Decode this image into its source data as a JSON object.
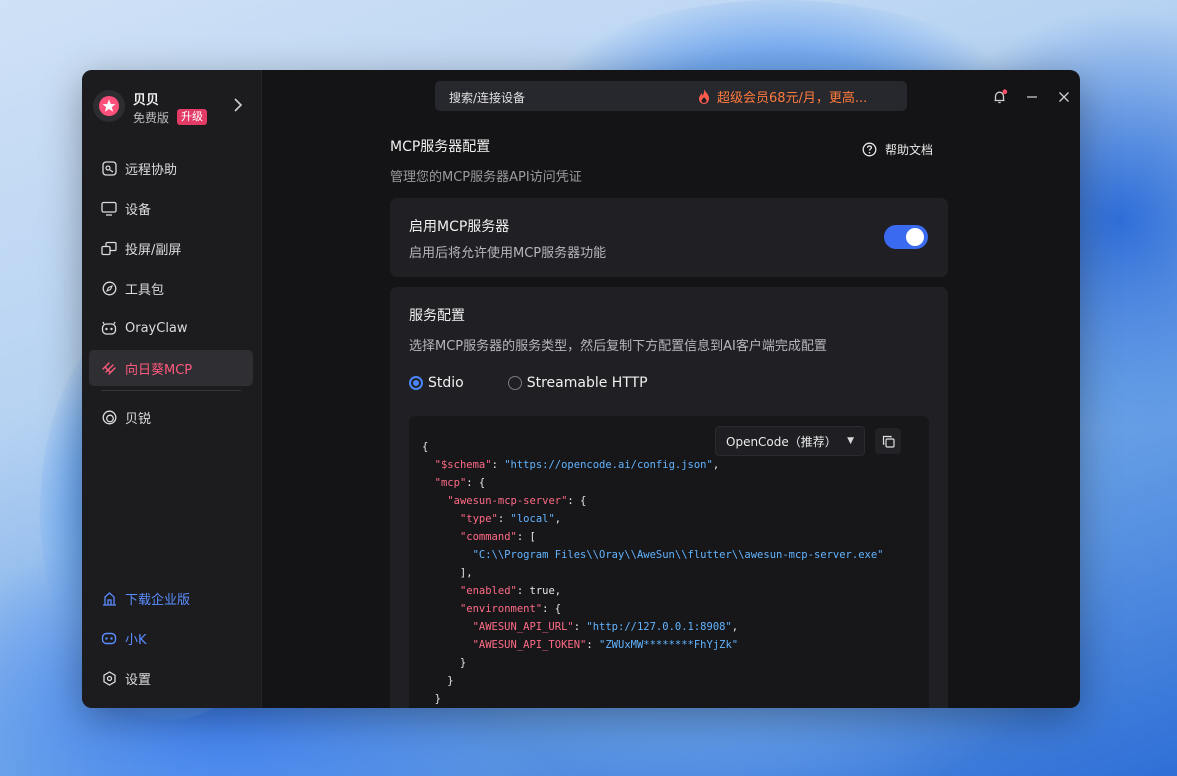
{
  "app": {
    "profile": {
      "name": "贝贝",
      "plan": "免费版",
      "upgrade": "升级"
    },
    "nav": [
      {
        "label": "远程协助",
        "icon": "remote-assist-icon"
      },
      {
        "label": "设备",
        "icon": "monitor-icon"
      },
      {
        "label": "投屏/副屏",
        "icon": "cast-screen-icon"
      },
      {
        "label": "工具包",
        "icon": "compass-icon"
      },
      {
        "label": "OrayClaw",
        "icon": "claw-robot-icon"
      },
      {
        "label": "向日葵MCP",
        "icon": "mcp-icon",
        "active": true
      },
      {
        "label": "贝锐",
        "icon": "oray-icon"
      }
    ],
    "nav_bottom": [
      {
        "label": "下载企业版",
        "icon": "enterprise-building-icon"
      },
      {
        "label": "小K",
        "icon": "assistant-k-icon"
      },
      {
        "label": "设置",
        "icon": "settings-hexagon-icon"
      }
    ],
    "accent": "#ff5a7d"
  },
  "topbar": {
    "search_placeholder": "搜索/连接设备",
    "promo": "超级会员68元/月，更高..."
  },
  "page": {
    "title": "MCP服务器配置",
    "subtitle": "管理您的MCP服务器API访问凭证",
    "help": "帮助文档",
    "enable_card": {
      "title": "启用MCP服务器",
      "desc": "启用后将允许使用MCP服务器功能",
      "enabled": true
    },
    "service_card": {
      "title": "服务配置",
      "desc": "选择MCP服务器的服务类型，然后复制下方配置信息到AI客户端完成配置",
      "options": [
        "Stdio",
        "Streamable HTTP"
      ],
      "selected": "Stdio",
      "client_select": "OpenCode（推荐）",
      "code": {
        "schema_key": "\"$schema\"",
        "schema_val": "\"https://opencode.ai/config.json\"",
        "mcp_key": "\"mcp\"",
        "server_key": "\"awesun-mcp-server\"",
        "type_key": "\"type\"",
        "type_val": "\"local\"",
        "command_key": "\"command\"",
        "command_val": "\"C:\\\\Program Files\\\\Oray\\\\AweSun\\\\flutter\\\\awesun-mcp-server.exe\"",
        "enabled_key": "\"enabled\"",
        "enabled_val": "true",
        "env_key": "\"environment\"",
        "api_url_key": "\"AWESUN_API_URL\"",
        "api_url_val": "\"http://127.0.0.1:8908\"",
        "api_token_key": "\"AWESUN_API_TOKEN\"",
        "api_token_val": "\"ZWUxMW********FhYjZk\""
      }
    }
  }
}
